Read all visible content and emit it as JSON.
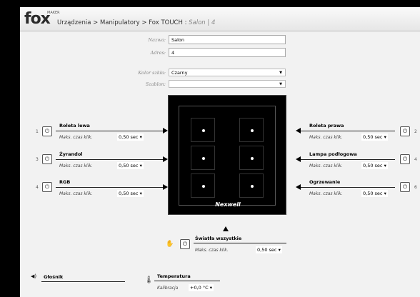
{
  "header": {
    "logo_text": "fox",
    "logo_small": "MAKER",
    "breadcrumb_main": "Urządzenia > Manipulatory > Fox TOUCH : ",
    "breadcrumb_place": "Salon | 4"
  },
  "form": {
    "name_label": "Nazwa:",
    "name_value": "Salon",
    "address_label": "Adres:",
    "address_value": "4",
    "glass_label": "Kolor szkła:",
    "glass_value": "Czarny",
    "template_label": "Szablon:",
    "template_value": ""
  },
  "channels": {
    "left": [
      {
        "num": "1",
        "title": "Roleta lewa",
        "sub": "Maks. czas klik.",
        "sel": "0,50 sec"
      },
      {
        "num": "3",
        "title": "Żyrandol",
        "sub": "Maks. czas klik.",
        "sel": "0,50 sec"
      },
      {
        "num": "4",
        "title": "RGB",
        "sub": "Maks. czas klik.",
        "sel": "0,50 sec"
      }
    ],
    "right": [
      {
        "num": "2",
        "title": "Roleta prawa",
        "sub": "Maks. czas klik.",
        "sel": "0,50 sec"
      },
      {
        "num": "4",
        "title": "Lampa podłogowa",
        "sub": "Maks. czas klik.",
        "sel": "0,50 sec"
      },
      {
        "num": "6",
        "title": "Ogrzewanie",
        "sub": "Maks. czas klik.",
        "sel": "0,50 sec"
      }
    ],
    "bottom": {
      "title": "Światła wszystkie",
      "sub": "Maks. czas klik.",
      "sel": "0,50 sec"
    }
  },
  "device": {
    "brand": "Nexwell"
  },
  "footer": {
    "speaker_label": "Głośnik",
    "temp_title": "Temperatura",
    "temp_sub": "Kalibracja",
    "temp_value": "+0,0 °C"
  },
  "icons": {
    "power": "power-icon",
    "arrow": "chevron-down-icon"
  }
}
